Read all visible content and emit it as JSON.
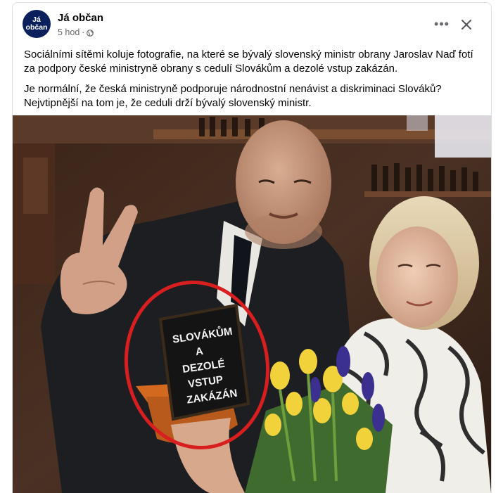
{
  "post": {
    "author": "Já občan",
    "avatar_text": [
      "Já",
      "občan"
    ],
    "time": "5 hod",
    "separator": "·",
    "paragraphs": [
      "Sociálními sítěmi koluje fotografie, na které se bývalý slovenský ministr obrany Jaroslav Naď fotí za podpory české ministryně obrany s cedulí Slovákům a dezolé vstup zakázán.",
      "Je normální, že česká ministryně podporuje národnostní nenávist a diskriminaci Slováků? Nejvtipnější na tom je, že ceduli drží bývalý slovenský ministr."
    ],
    "more_label": "•••",
    "photo": {
      "sign_lines": [
        "SLOVÁKŮM",
        "A",
        "DEZOLÉ",
        "VSTUP",
        "ZAKÁZÁN"
      ]
    }
  },
  "icons": {
    "privacy": "globe-icon",
    "more": "more-options-icon",
    "close": "close-icon"
  },
  "colors": {
    "avatar_bg": "#0b1f5c",
    "highlight_circle": "#d81e1e",
    "meta_text": "#65676b"
  }
}
